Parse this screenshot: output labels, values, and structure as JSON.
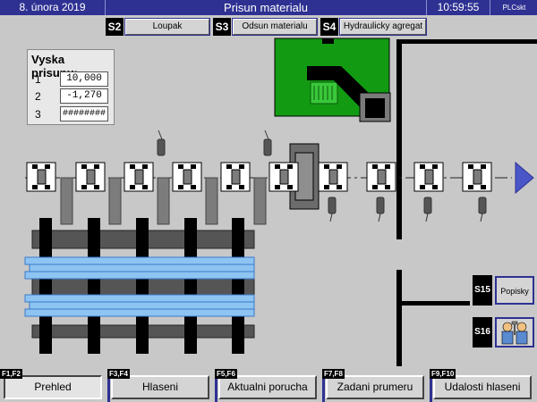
{
  "header": {
    "date": "8. února 2019",
    "title": "Prisun materialu",
    "time": "10:59:55",
    "logo": "PLCskt"
  },
  "sections": [
    {
      "code": "S2",
      "label": "Loupak"
    },
    {
      "code": "S3",
      "label": "Odsun materialu"
    },
    {
      "code": "S4",
      "label": "Hydraulicky agregat"
    }
  ],
  "feed_height": {
    "title": "Vyska prisunu:",
    "rows": [
      {
        "index": "1",
        "value": "10,000"
      },
      {
        "index": "2",
        "value": "-1,270"
      },
      {
        "index": "3",
        "value": "########"
      }
    ]
  },
  "side": {
    "s15": {
      "code": "S15",
      "label": "Popisky"
    },
    "s16": {
      "code": "S16",
      "icon": "maintenance-workers-icon"
    }
  },
  "footer": [
    {
      "keys": "F1,F2",
      "label": "Prehled"
    },
    {
      "keys": "F3,F4",
      "label": "Hlaseni"
    },
    {
      "keys": "F5,F6",
      "label": "Aktualni porucha"
    },
    {
      "keys": "F7,F8",
      "label": "Zadani prumeru"
    },
    {
      "keys": "F9,F10",
      "label": "Udalosti hlaseni"
    }
  ],
  "colors": {
    "accent": "#2e3192",
    "background": "#c8c8c8",
    "green_panel": "#129b12",
    "material": "#8ec4f2",
    "arrow": "#4a56c8"
  }
}
